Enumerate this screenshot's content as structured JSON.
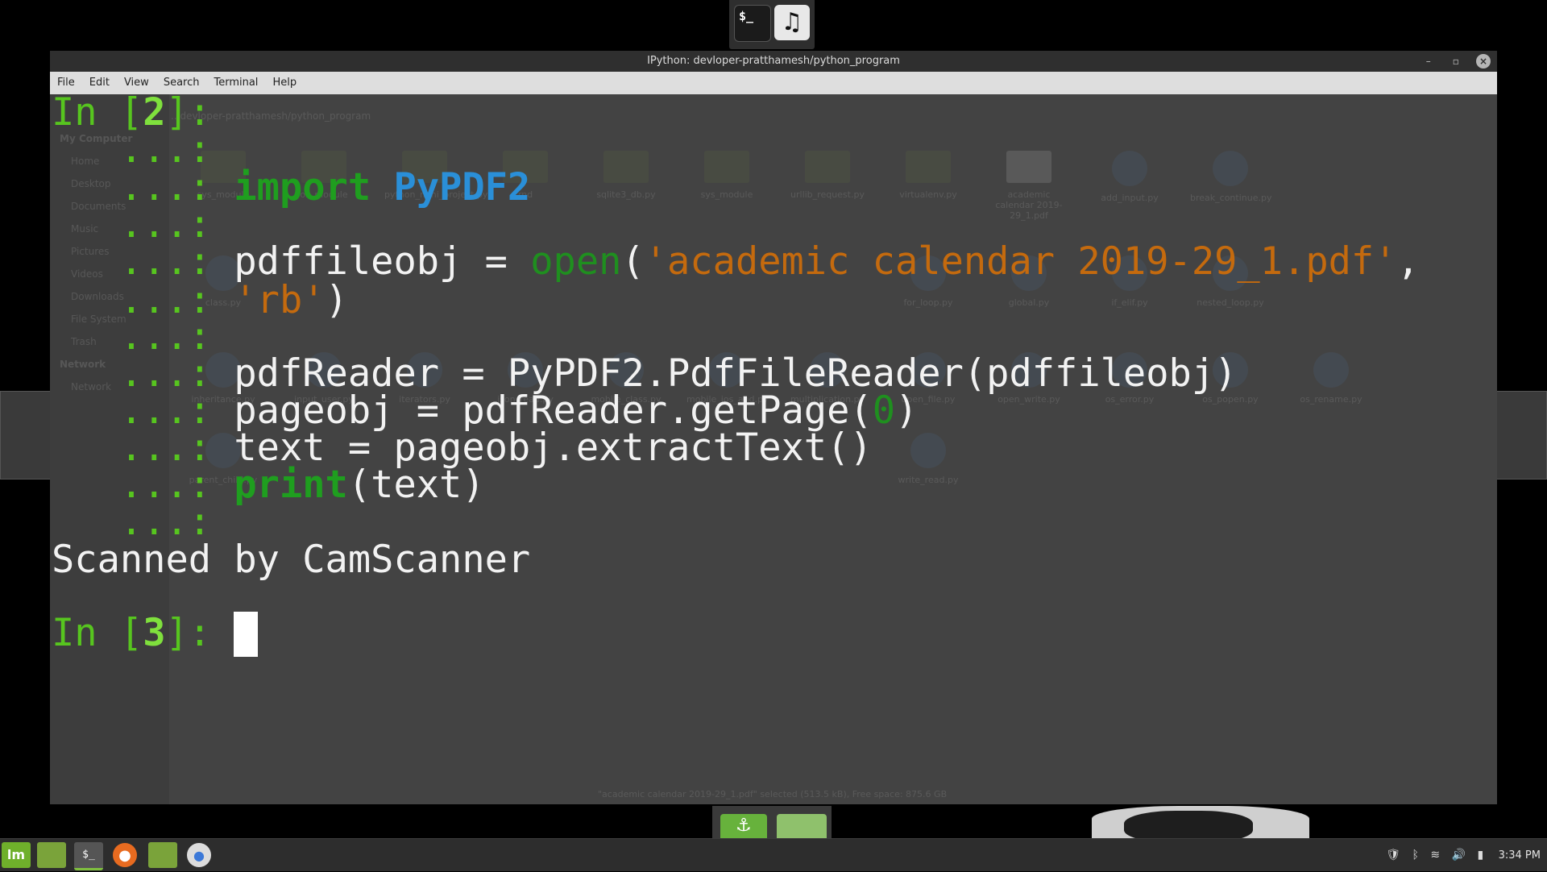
{
  "window": {
    "title": "IPython: devloper-pratthamesh/python_program",
    "controls": {
      "minimize": "–",
      "maximize": "▫",
      "close": "×"
    }
  },
  "menubar": [
    "File",
    "Edit",
    "View",
    "Search",
    "Terminal",
    "Help"
  ],
  "background_file_manager": {
    "path": "...devloper-pratthamesh/python_program",
    "sidebar": [
      "My Computer",
      "Home",
      "Desktop",
      "Documents",
      "Music",
      "Pictures",
      "Videos",
      "Downloads",
      "File System",
      "Trash",
      "Network",
      "Network"
    ],
    "files": [
      "sys_module",
      "os_module",
      "python_mini_project.py",
      "rnd",
      "sqlite3_db.py",
      "sys_module",
      "urllib_request.py",
      "virtualenv.py",
      "academic calendar 2019-29_1.pdf",
      "add_input.py",
      "break_continue.py",
      "class.py",
      "for_loop.py",
      "global.py",
      "if_elif.py",
      "nested_loop.py",
      "inheritance.py",
      "input_user.py",
      "iterators.py",
      "json_read.py",
      "mobile_class.py",
      "mobile_ios_and.py",
      "multiplication.py",
      "open_file.py",
      "open_write.py",
      "os_error.py",
      "os_popen.py",
      "os_rename.py",
      "parent_child.py",
      "write_read.py"
    ],
    "status": "\"academic calendar 2019-29_1.pdf\" selected (513.5 kB), Free space: 875.6 GB"
  },
  "terminal": {
    "prompt_in_2": "In [",
    "prompt_num_2": "2",
    "prompt_close_2": "]: ",
    "continuation": "   ...: ",
    "import_kw": "import",
    "import_mod": "PyPDF2",
    "line_pdffileobj_lhs": "pdffileobj = ",
    "open_fn": "open",
    "open_paren": "(",
    "open_str1": "'academic calendar 2019-29_1.pdf'",
    "comma": ", ",
    "open_str2": "'rb'",
    "close_paren": ")",
    "line_reader": "pdfReader = PyPDF2.PdfFileReader(pdffileobj)",
    "line_pageobj_a": "pageobj = pdfReader.getPage(",
    "line_pageobj_num": "0",
    "line_pageobj_b": ")",
    "line_text": "text = pageobj.extractText()",
    "print_fn": "print",
    "print_args": "(text)",
    "output": "Scanned by CamScanner",
    "prompt_in_3": "In [",
    "prompt_num_3": "3",
    "prompt_close_3": "]: "
  },
  "dock_top": {
    "terminal_glyph": "$_",
    "music_glyph": "♫"
  },
  "taskbar": {
    "mint_glyph": "lm",
    "terminal_glyph": "$_",
    "clock": "3:34 PM"
  }
}
